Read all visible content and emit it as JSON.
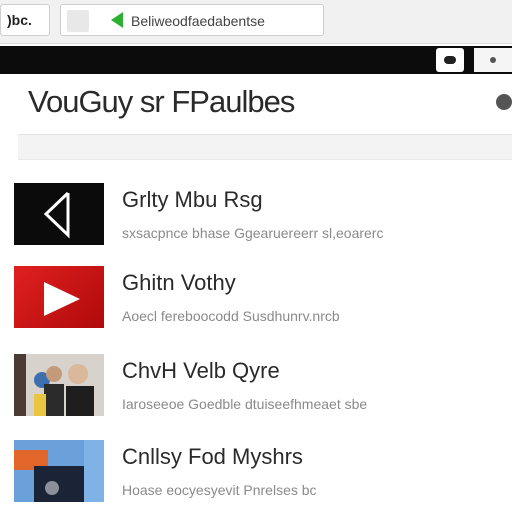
{
  "browser": {
    "tab_label": ")bc.",
    "address": "Beliweodfaedabentse"
  },
  "page": {
    "title": "VouGuy sr FPaulbes"
  },
  "items": [
    {
      "title": "Grlty Mbu Rsg",
      "subtitle": "sxsacpnce bhase Ggearuereerr sl,eoarerc",
      "thumb": "back-arrow-icon"
    },
    {
      "title": "Ghitn Vothy",
      "subtitle": "Aoecl fereboocodd Susdhunrv.nrcb",
      "thumb": "play-icon"
    },
    {
      "title": "ChvH Velb Qyre",
      "subtitle": "Iaroseeoe Goedble dtuiseefhmeaet sbe",
      "thumb": "people-photo"
    },
    {
      "title": "Cnllsy Fod Myshrs",
      "subtitle": "Hoase eocyesyevit Pnrelses bc",
      "thumb": "scene-photo"
    }
  ]
}
